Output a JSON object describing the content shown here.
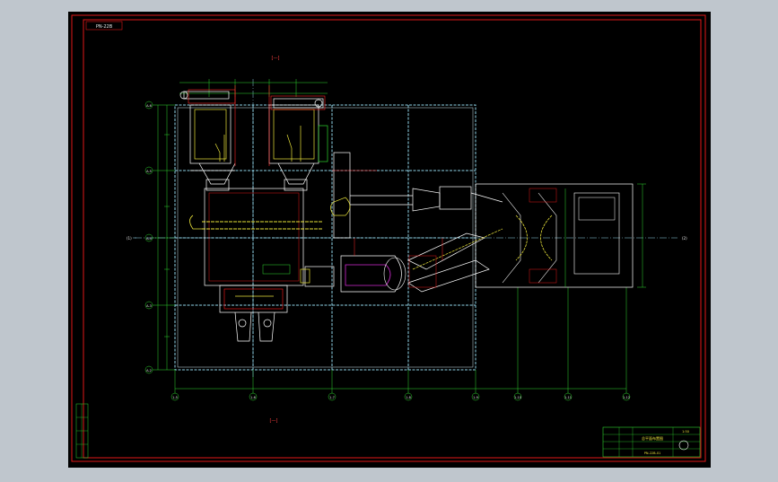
{
  "viewport": {
    "background": "#bfc6cd",
    "sheet_color": "#000000"
  },
  "colors": {
    "frame": "#e01818",
    "grid": "#8fd3e8",
    "equip": "#ffffff",
    "dim": "#2fd62f",
    "yellow": "#e8e23a",
    "magenta": "#d22ad2",
    "red": "#ff2a2a"
  },
  "drawing": {
    "tag_top_left": "PN-22B",
    "section_mark_top": "[—]",
    "section_mark_bottom": "[—]",
    "row_labels": [
      "A-6",
      "A-5",
      "A-4",
      "A-3",
      "A-2"
    ],
    "column_labels": [
      "1-5",
      "1-6",
      "1-7",
      "1-8",
      "1-9",
      "1-10",
      "1-11",
      "1-12"
    ],
    "side_axis_left": "(1)",
    "side_axis_right": "(2)"
  },
  "title_block": {
    "title": "总平面布置图",
    "scale": "1:50",
    "drawing_no": "PN-22B-01"
  }
}
